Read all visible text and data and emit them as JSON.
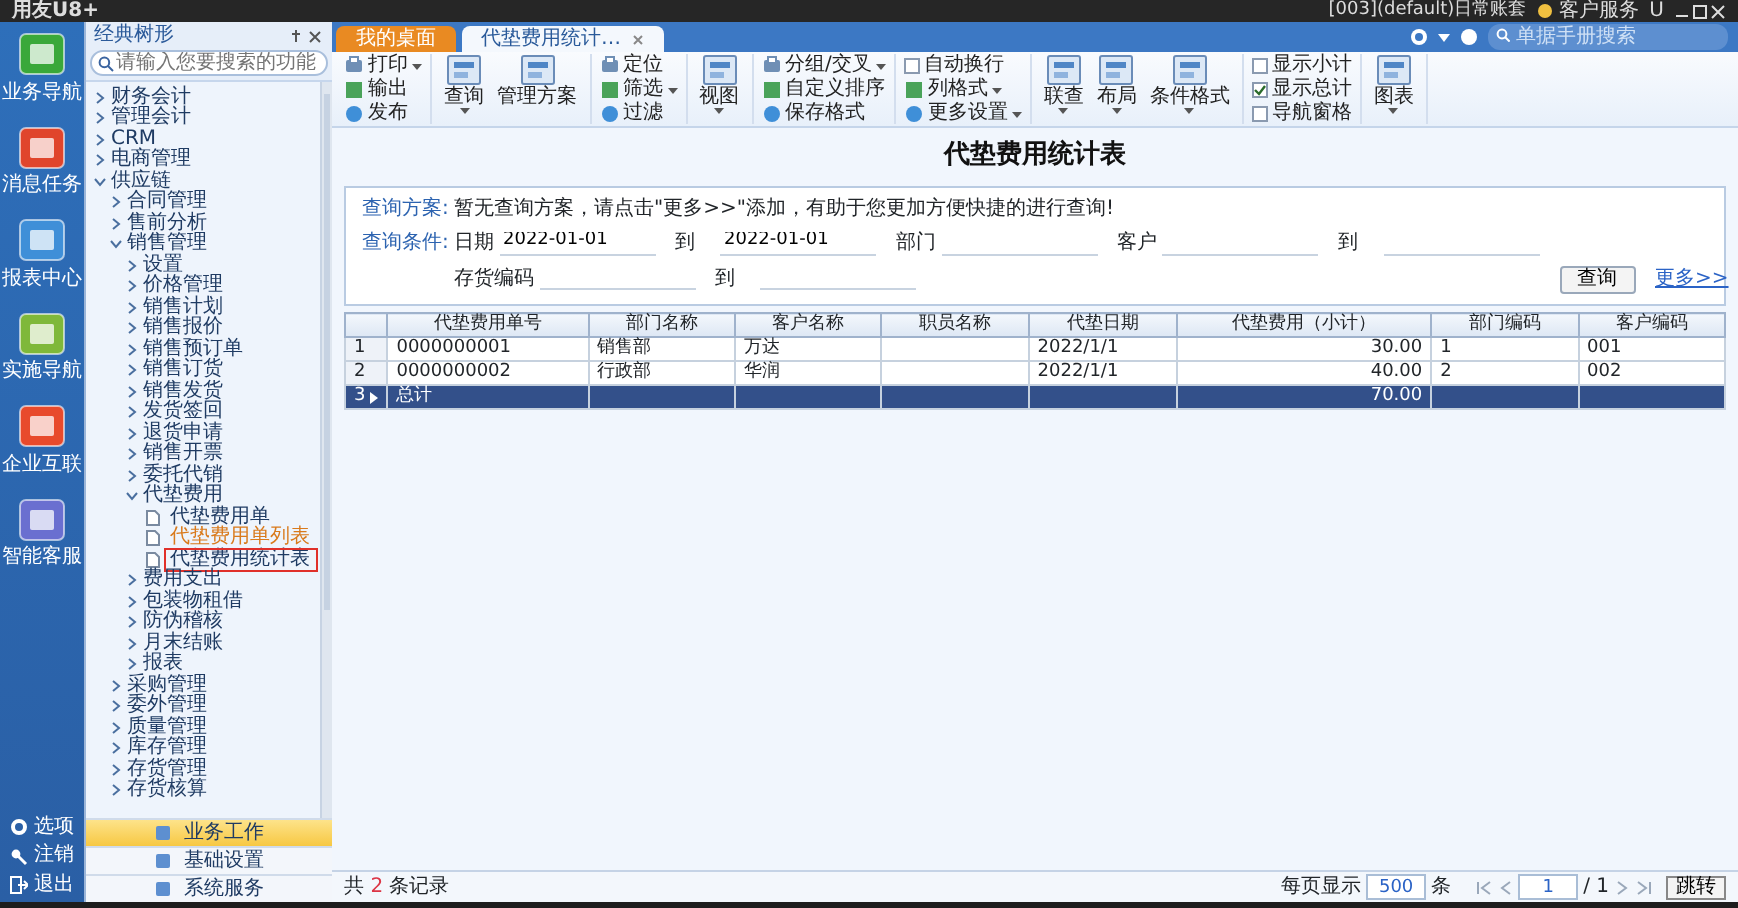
{
  "title_bar": {
    "logo": "用友U8+",
    "account": "[003](default)日常账套",
    "service": "客户服务",
    "user": "U"
  },
  "rail": {
    "items": [
      {
        "label": "业务导航",
        "color": "#3aa83a"
      },
      {
        "label": "消息任务",
        "color": "#e0452c"
      },
      {
        "label": "报表中心",
        "color": "#3f8fd8"
      },
      {
        "label": "实施导航",
        "color": "#7fb83a"
      },
      {
        "label": "企业互联",
        "color": "#e84a2c"
      },
      {
        "label": "智能客服",
        "color": "#6a6fd0"
      }
    ],
    "bottom": [
      {
        "label": "选项",
        "kind": "gear"
      },
      {
        "label": "注销",
        "kind": "key"
      },
      {
        "label": "退出",
        "kind": "exit"
      }
    ]
  },
  "nav": {
    "title": "经典树形",
    "search_placeholder": "请输入您要搜索的功能",
    "tree": [
      {
        "label": "财务会计",
        "expanded": false
      },
      {
        "label": "管理会计",
        "expanded": false
      },
      {
        "label": "CRM",
        "expanded": false
      },
      {
        "label": "电商管理",
        "expanded": false
      },
      {
        "label": "供应链",
        "expanded": true,
        "children": [
          {
            "label": "合同管理",
            "expanded": false
          },
          {
            "label": "售前分析",
            "expanded": false
          },
          {
            "label": "销售管理",
            "expanded": true,
            "children": [
              {
                "label": "设置",
                "expanded": false
              },
              {
                "label": "价格管理",
                "expanded": false
              },
              {
                "label": "销售计划",
                "expanded": false
              },
              {
                "label": "销售报价",
                "expanded": false
              },
              {
                "label": "销售预订单",
                "expanded": false
              },
              {
                "label": "销售订货",
                "expanded": false
              },
              {
                "label": "销售发货",
                "expanded": false
              },
              {
                "label": "发货签回",
                "expanded": false
              },
              {
                "label": "退货申请",
                "expanded": false
              },
              {
                "label": "销售开票",
                "expanded": false
              },
              {
                "label": "委托代销",
                "expanded": false
              },
              {
                "label": "代垫费用",
                "expanded": true,
                "pages": [
                  {
                    "label": "代垫费用单",
                    "selected": false,
                    "highlighted": false
                  },
                  {
                    "label": "代垫费用单列表",
                    "selected": false,
                    "highlighted": true
                  },
                  {
                    "label": "代垫费用统计表",
                    "selected": true,
                    "highlighted": false
                  }
                ]
              },
              {
                "label": "费用支出",
                "expanded": false
              },
              {
                "label": "包装物租借",
                "expanded": false
              },
              {
                "label": "防伪稽核",
                "expanded": false
              },
              {
                "label": "月末结账",
                "expanded": false
              },
              {
                "label": "报表",
                "expanded": false
              }
            ]
          },
          {
            "label": "采购管理",
            "expanded": false
          },
          {
            "label": "委外管理",
            "expanded": false
          },
          {
            "label": "质量管理",
            "expanded": false
          },
          {
            "label": "库存管理",
            "expanded": false
          },
          {
            "label": "存货管理",
            "expanded": false
          },
          {
            "label": "存货核算",
            "expanded": false
          }
        ]
      }
    ],
    "sections": [
      {
        "label": "业务工作",
        "selected": true
      },
      {
        "label": "基础设置",
        "selected": false
      },
      {
        "label": "系统服务",
        "selected": false
      }
    ]
  },
  "tabs": [
    {
      "label": "我的桌面",
      "selected": false,
      "closable": false
    },
    {
      "label": "代垫费用统计…",
      "selected": true,
      "closable": true
    }
  ],
  "top_search": {
    "placeholder": "单据手册搜索"
  },
  "ribbon": {
    "groups": [
      {
        "items": [
          {
            "label": "打印",
            "kind": "small",
            "dropdown": true
          },
          {
            "label": "输出",
            "kind": "small",
            "dropdown": false
          },
          {
            "label": "发布",
            "kind": "small",
            "dropdown": false
          }
        ]
      },
      {
        "items": [
          {
            "label": "查询",
            "kind": "large",
            "dropdown": true
          },
          {
            "label": "管理方案",
            "kind": "large",
            "dropdown": false
          }
        ]
      },
      {
        "items": [
          {
            "label": "定位",
            "kind": "small",
            "dropdown": false
          },
          {
            "label": "筛选",
            "kind": "small",
            "dropdown": true
          },
          {
            "label": "过滤",
            "kind": "small",
            "dropdown": false
          }
        ]
      },
      {
        "items": [
          {
            "label": "视图",
            "kind": "large",
            "dropdown": true
          }
        ]
      },
      {
        "items": [
          {
            "label": "分组/交叉",
            "kind": "small",
            "dropdown": true
          },
          {
            "label": "自定义排序",
            "kind": "small",
            "dropdown": false
          },
          {
            "label": "保存格式",
            "kind": "small",
            "dropdown": false
          }
        ]
      },
      {
        "items": [
          {
            "label": "自动换行",
            "kind": "check",
            "checked": false
          },
          {
            "label": "列格式",
            "kind": "small",
            "dropdown": true
          },
          {
            "label": "更多设置",
            "kind": "small",
            "dropdown": true
          }
        ]
      },
      {
        "items": [
          {
            "label": "联查",
            "kind": "large",
            "dropdown": true
          },
          {
            "label": "布局",
            "kind": "large",
            "dropdown": true
          },
          {
            "label": "条件格式",
            "kind": "large",
            "dropdown": true
          }
        ]
      },
      {
        "items": [
          {
            "label": "显示小计",
            "kind": "check",
            "checked": false
          },
          {
            "label": "显示总计",
            "kind": "check",
            "checked": true
          },
          {
            "label": "导航窗格",
            "kind": "check",
            "checked": false
          }
        ]
      },
      {
        "items": [
          {
            "label": "图表",
            "kind": "large",
            "dropdown": true
          }
        ]
      }
    ]
  },
  "report": {
    "title": "代垫费用统计表",
    "query": {
      "scheme_label": "查询方案:",
      "scheme_text": "暂无查询方案，请点击\"更多>>\"添加，有助于您更加方便快捷的进行查询!",
      "conditions_label": "查询条件:",
      "rows": [
        [
          {
            "label": "日期",
            "value": "2022-01-01"
          },
          {
            "label": "到",
            "value": "2022-01-01"
          },
          {
            "label": "部门"
          },
          {
            "label": "客户"
          },
          {
            "label": "到"
          }
        ],
        [
          {
            "label": "存货编码"
          },
          {
            "label": "到"
          }
        ]
      ],
      "query_button": "查询",
      "more_link": "更多>>"
    },
    "table": {
      "columns": [
        "代垫费用单号",
        "部门名称",
        "客户名称",
        "职员名称",
        "代垫日期",
        "代垫费用（小计）",
        "部门编码",
        "客户编码"
      ],
      "rows": [
        {
          "number": "1",
          "selected": false,
          "cells": [
            "0000000001",
            "销售部",
            "万达",
            "",
            "2022/1/1",
            "30.00",
            "1",
            "001"
          ]
        },
        {
          "number": "2",
          "selected": false,
          "cells": [
            "0000000002",
            "行政部",
            "华润",
            "",
            "2022/1/1",
            "40.00",
            "2",
            "002"
          ]
        },
        {
          "number": "3",
          "selected": true,
          "cells": [
            "总计",
            "",
            "",
            "",
            "",
            "70.00",
            "",
            ""
          ]
        }
      ]
    }
  },
  "status_bar": {
    "prefix": "共",
    "count": "2",
    "suffix": "条记录",
    "per_page_label": "每页显示",
    "per_page": "500",
    "per_page_unit": "条",
    "page": "1",
    "total_pages": "/ 1",
    "jump": "跳转"
  }
}
